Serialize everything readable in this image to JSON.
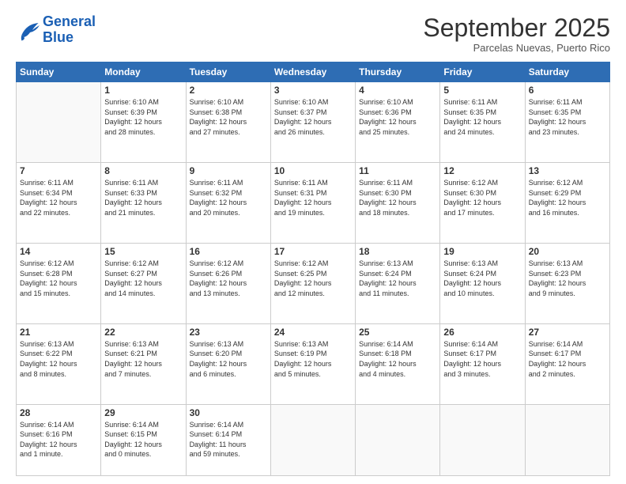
{
  "header": {
    "logo_line1": "General",
    "logo_line2": "Blue",
    "month": "September 2025",
    "location": "Parcelas Nuevas, Puerto Rico"
  },
  "days_of_week": [
    "Sunday",
    "Monday",
    "Tuesday",
    "Wednesday",
    "Thursday",
    "Friday",
    "Saturday"
  ],
  "weeks": [
    [
      {
        "day": "",
        "text": ""
      },
      {
        "day": "1",
        "text": "Sunrise: 6:10 AM\nSunset: 6:39 PM\nDaylight: 12 hours\nand 28 minutes."
      },
      {
        "day": "2",
        "text": "Sunrise: 6:10 AM\nSunset: 6:38 PM\nDaylight: 12 hours\nand 27 minutes."
      },
      {
        "day": "3",
        "text": "Sunrise: 6:10 AM\nSunset: 6:37 PM\nDaylight: 12 hours\nand 26 minutes."
      },
      {
        "day": "4",
        "text": "Sunrise: 6:10 AM\nSunset: 6:36 PM\nDaylight: 12 hours\nand 25 minutes."
      },
      {
        "day": "5",
        "text": "Sunrise: 6:11 AM\nSunset: 6:35 PM\nDaylight: 12 hours\nand 24 minutes."
      },
      {
        "day": "6",
        "text": "Sunrise: 6:11 AM\nSunset: 6:35 PM\nDaylight: 12 hours\nand 23 minutes."
      }
    ],
    [
      {
        "day": "7",
        "text": "Sunrise: 6:11 AM\nSunset: 6:34 PM\nDaylight: 12 hours\nand 22 minutes."
      },
      {
        "day": "8",
        "text": "Sunrise: 6:11 AM\nSunset: 6:33 PM\nDaylight: 12 hours\nand 21 minutes."
      },
      {
        "day": "9",
        "text": "Sunrise: 6:11 AM\nSunset: 6:32 PM\nDaylight: 12 hours\nand 20 minutes."
      },
      {
        "day": "10",
        "text": "Sunrise: 6:11 AM\nSunset: 6:31 PM\nDaylight: 12 hours\nand 19 minutes."
      },
      {
        "day": "11",
        "text": "Sunrise: 6:11 AM\nSunset: 6:30 PM\nDaylight: 12 hours\nand 18 minutes."
      },
      {
        "day": "12",
        "text": "Sunrise: 6:12 AM\nSunset: 6:30 PM\nDaylight: 12 hours\nand 17 minutes."
      },
      {
        "day": "13",
        "text": "Sunrise: 6:12 AM\nSunset: 6:29 PM\nDaylight: 12 hours\nand 16 minutes."
      }
    ],
    [
      {
        "day": "14",
        "text": "Sunrise: 6:12 AM\nSunset: 6:28 PM\nDaylight: 12 hours\nand 15 minutes."
      },
      {
        "day": "15",
        "text": "Sunrise: 6:12 AM\nSunset: 6:27 PM\nDaylight: 12 hours\nand 14 minutes."
      },
      {
        "day": "16",
        "text": "Sunrise: 6:12 AM\nSunset: 6:26 PM\nDaylight: 12 hours\nand 13 minutes."
      },
      {
        "day": "17",
        "text": "Sunrise: 6:12 AM\nSunset: 6:25 PM\nDaylight: 12 hours\nand 12 minutes."
      },
      {
        "day": "18",
        "text": "Sunrise: 6:13 AM\nSunset: 6:24 PM\nDaylight: 12 hours\nand 11 minutes."
      },
      {
        "day": "19",
        "text": "Sunrise: 6:13 AM\nSunset: 6:24 PM\nDaylight: 12 hours\nand 10 minutes."
      },
      {
        "day": "20",
        "text": "Sunrise: 6:13 AM\nSunset: 6:23 PM\nDaylight: 12 hours\nand 9 minutes."
      }
    ],
    [
      {
        "day": "21",
        "text": "Sunrise: 6:13 AM\nSunset: 6:22 PM\nDaylight: 12 hours\nand 8 minutes."
      },
      {
        "day": "22",
        "text": "Sunrise: 6:13 AM\nSunset: 6:21 PM\nDaylight: 12 hours\nand 7 minutes."
      },
      {
        "day": "23",
        "text": "Sunrise: 6:13 AM\nSunset: 6:20 PM\nDaylight: 12 hours\nand 6 minutes."
      },
      {
        "day": "24",
        "text": "Sunrise: 6:13 AM\nSunset: 6:19 PM\nDaylight: 12 hours\nand 5 minutes."
      },
      {
        "day": "25",
        "text": "Sunrise: 6:14 AM\nSunset: 6:18 PM\nDaylight: 12 hours\nand 4 minutes."
      },
      {
        "day": "26",
        "text": "Sunrise: 6:14 AM\nSunset: 6:17 PM\nDaylight: 12 hours\nand 3 minutes."
      },
      {
        "day": "27",
        "text": "Sunrise: 6:14 AM\nSunset: 6:17 PM\nDaylight: 12 hours\nand 2 minutes."
      }
    ],
    [
      {
        "day": "28",
        "text": "Sunrise: 6:14 AM\nSunset: 6:16 PM\nDaylight: 12 hours\nand 1 minute."
      },
      {
        "day": "29",
        "text": "Sunrise: 6:14 AM\nSunset: 6:15 PM\nDaylight: 12 hours\nand 0 minutes."
      },
      {
        "day": "30",
        "text": "Sunrise: 6:14 AM\nSunset: 6:14 PM\nDaylight: 11 hours\nand 59 minutes."
      },
      {
        "day": "",
        "text": ""
      },
      {
        "day": "",
        "text": ""
      },
      {
        "day": "",
        "text": ""
      },
      {
        "day": "",
        "text": ""
      }
    ]
  ]
}
